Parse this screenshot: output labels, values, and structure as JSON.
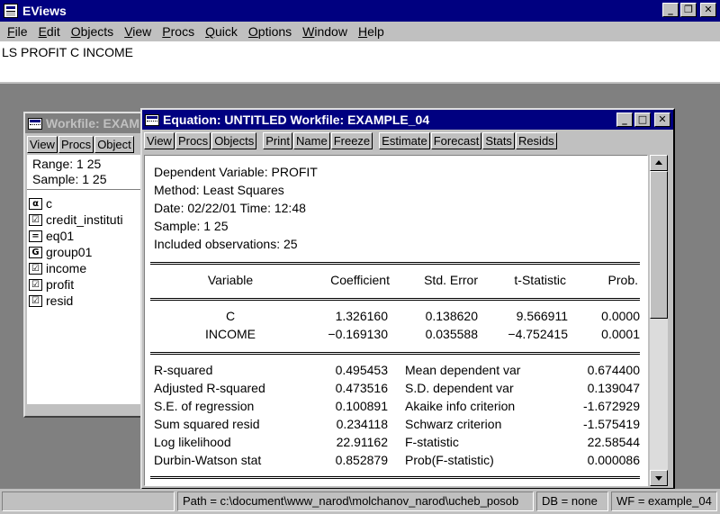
{
  "app": {
    "title": "EViews",
    "menu": [
      "File",
      "Edit",
      "Objects",
      "View",
      "Procs",
      "Quick",
      "Options",
      "Window",
      "Help"
    ],
    "command_text": "LS  PROFIT C INCOME"
  },
  "window_controls": {
    "minimize": "_",
    "restore": "❐",
    "close": "✕",
    "maximize": "□"
  },
  "workfile": {
    "title": "Workfile: EXAM",
    "toolbar": [
      "View",
      "Procs",
      "Object"
    ],
    "range": "Range:   1 25",
    "sample": "Sample: 1 25",
    "objects": [
      {
        "icon_text": "α",
        "name": "c"
      },
      {
        "icon_text": "☑",
        "name": "credit_instituti"
      },
      {
        "icon_text": "=",
        "name": "eq01"
      },
      {
        "icon_text": "G",
        "name": "group01"
      },
      {
        "icon_text": "☑",
        "name": "income"
      },
      {
        "icon_text": "☑",
        "name": "profit"
      },
      {
        "icon_text": "☑",
        "name": "resid"
      }
    ]
  },
  "equation": {
    "title": "Equation: UNTITLED   Workfile: EXAMPLE_04",
    "toolbar_group1": [
      "View",
      "Procs",
      "Objects"
    ],
    "toolbar_group2": [
      "Print",
      "Name",
      "Freeze"
    ],
    "toolbar_group3": [
      "Estimate",
      "Forecast",
      "Stats",
      "Resids"
    ],
    "header": {
      "dependent": "Dependent Variable: PROFIT",
      "method": "Method: Least Squares",
      "date": "Date: 02/22/01   Time: 12:48",
      "sample": "Sample: 1 25",
      "observations": "Included observations: 25"
    },
    "columns": [
      "Variable",
      "Coefficient",
      "Std. Error",
      "t-Statistic",
      "Prob."
    ],
    "rows": [
      {
        "variable": "C",
        "coefficient": "1.326160",
        "std_error": "0.138620",
        "t_stat": "9.566911",
        "prob": "0.0000"
      },
      {
        "variable": "INCOME",
        "coefficient": "−0.169130",
        "std_error": "0.035588",
        "t_stat": "−4.752415",
        "prob": "0.0001"
      }
    ],
    "stats": [
      {
        "label1": "R-squared",
        "value1": "0.495453",
        "label2": "Mean dependent var",
        "value2": "0.674400"
      },
      {
        "label1": "Adjusted R-squared",
        "value1": "0.473516",
        "label2": "S.D. dependent var",
        "value2": "0.139047"
      },
      {
        "label1": "S.E. of regression",
        "value1": "0.100891",
        "label2": "Akaike info criterion",
        "value2": "-1.672929"
      },
      {
        "label1": "Sum squared resid",
        "value1": "0.234118",
        "label2": "Schwarz criterion",
        "value2": "-1.575419"
      },
      {
        "label1": "Log likelihood",
        "value1": "22.91162",
        "label2": "F-statistic",
        "value2": "22.58544"
      },
      {
        "label1": "Durbin-Watson stat",
        "value1": "0.852879",
        "label2": "Prob(F-statistic)",
        "value2": "0.000086"
      }
    ]
  },
  "status": {
    "path": "Path = c:\\document\\www_narod\\molchanov_narod\\ucheb_posob",
    "db": "DB = none",
    "wf": "WF = example_04"
  }
}
